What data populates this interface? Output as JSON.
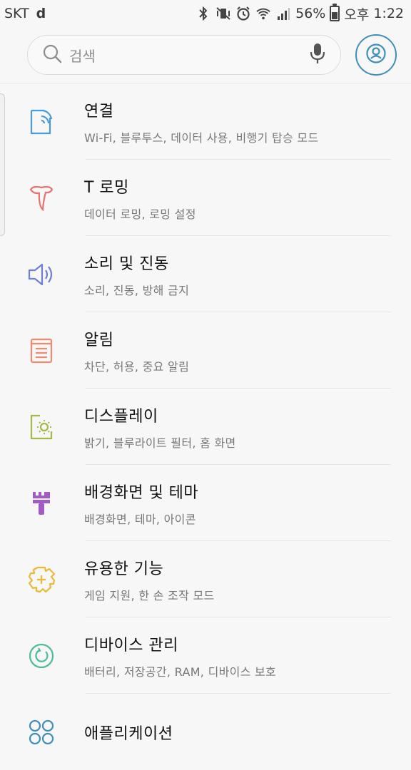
{
  "status_bar": {
    "carrier": "SKT",
    "carrier_badge": "d",
    "battery": "56%",
    "ampm": "오후",
    "time": "1:22"
  },
  "search": {
    "placeholder": "검색"
  },
  "settings": [
    {
      "title": "연결",
      "subtitle": "Wi-Fi, 블루투스, 데이터 사용, 비행기 탑승 모드",
      "icon": "connection-icon",
      "color": "#4a9bd6"
    },
    {
      "title": "T 로밍",
      "subtitle": "데이터 로밍, 로밍 설정",
      "icon": "t-roaming-icon",
      "color": "#e57373"
    },
    {
      "title": "소리 및 진동",
      "subtitle": "소리, 진동, 방해 금지",
      "icon": "speaker-icon",
      "color": "#6f7fd6"
    },
    {
      "title": "알림",
      "subtitle": "차단, 허용, 중요 알림",
      "icon": "notification-icon",
      "color": "#ef8a73"
    },
    {
      "title": "디스플레이",
      "subtitle": "밝기, 블루라이트 필터, 홈 화면",
      "icon": "display-icon",
      "color": "#a4b94a"
    },
    {
      "title": "배경화면 및 테마",
      "subtitle": "배경화면, 테마, 아이콘",
      "icon": "theme-brush-icon",
      "color": "#a05cc2"
    },
    {
      "title": "유용한 기능",
      "subtitle": "게임 지원, 한 손 조작 모드",
      "icon": "advanced-features-icon",
      "color": "#e8b93a"
    },
    {
      "title": "디바이스 관리",
      "subtitle": "배터리, 저장공간, RAM, 디바이스 보호",
      "icon": "device-maintenance-icon",
      "color": "#4dbb9b"
    },
    {
      "title": "애플리케이션",
      "subtitle": "",
      "icon": "apps-icon",
      "color": "#3f8fb8"
    }
  ]
}
